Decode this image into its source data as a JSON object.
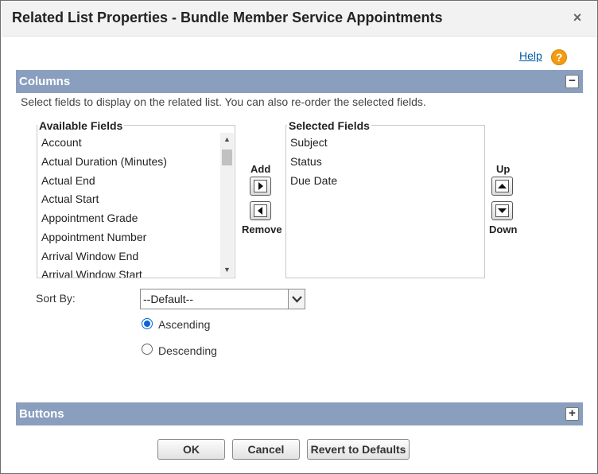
{
  "dialog": {
    "title": "Related List Properties - Bundle Member Service Appointments",
    "close_glyph": "×",
    "help_label": "Help",
    "help_glyph": "?"
  },
  "columns_section": {
    "title": "Columns",
    "toggle_glyph": "−",
    "instructions": "Select fields to display on the related list. You can also re-order the selected fields.",
    "available_label": "Available Fields",
    "available_fields": [
      "Account",
      "Actual Duration (Minutes)",
      "Actual End",
      "Actual Start",
      "Appointment Grade",
      "Appointment Number",
      "Arrival Window End",
      "Arrival Window Start"
    ],
    "selected_label": "Selected Fields",
    "selected_fields": [
      "Subject",
      "Status",
      "Due Date"
    ],
    "add_label": "Add",
    "remove_label": "Remove",
    "up_label": "Up",
    "down_label": "Down"
  },
  "sort": {
    "label": "Sort By:",
    "selected_value": "--Default--",
    "ascending_label": "Ascending",
    "descending_label": "Descending",
    "selected_order": "Ascending"
  },
  "buttons_section": {
    "title": "Buttons",
    "toggle_glyph": "+"
  },
  "footer": {
    "ok_label": "OK",
    "cancel_label": "Cancel",
    "revert_label": "Revert to Defaults"
  },
  "colors": {
    "section_bar": "#8a9ebe",
    "link": "#015ba7",
    "help_icon": "#f39c12",
    "radio_accent": "#0a64d6"
  },
  "icons": {
    "close": "close-icon",
    "help": "help-icon",
    "add": "arrow-right-icon",
    "remove": "arrow-left-icon",
    "up": "arrow-up-icon",
    "down": "arrow-down-icon",
    "select": "chevron-down-icon"
  }
}
